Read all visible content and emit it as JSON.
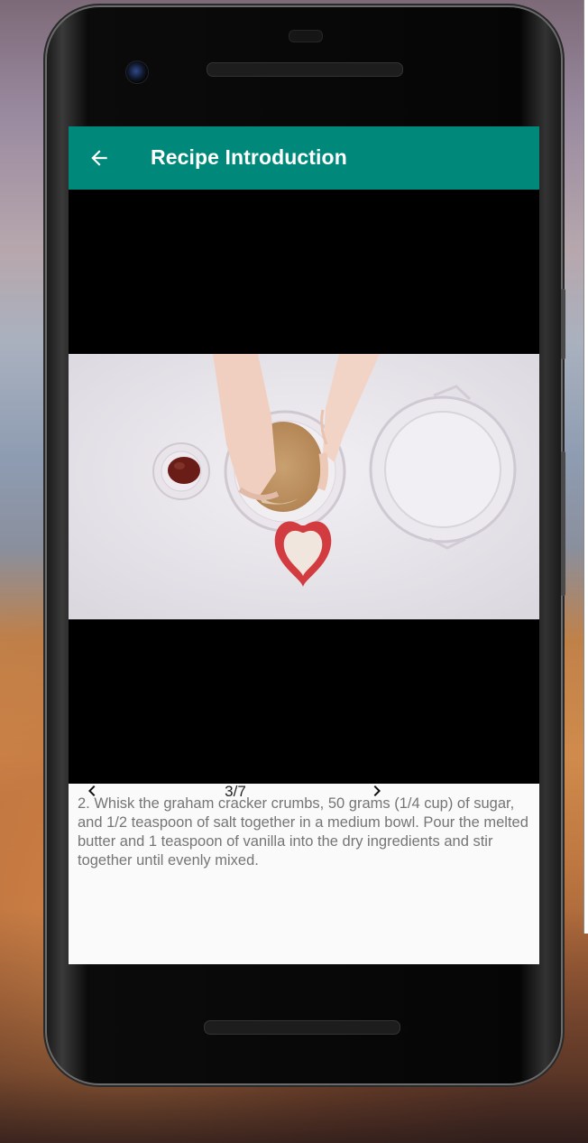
{
  "appbar": {
    "title": "Recipe Introduction",
    "back_icon": "arrow-left-icon",
    "color": "#00897b"
  },
  "media": {
    "icon": "video-frame"
  },
  "step": {
    "text": "2. Whisk the graham cracker crumbs, 50 grams (1/4 cup) of sugar, and 1/2 teaspoon of salt together in a medium bowl. Pour the melted butter and 1 teaspoon of vanilla into the dry ingredients and stir together until evenly mixed.",
    "counter": "3/7",
    "prev_icon": "chevron-left-icon",
    "next_icon": "chevron-right-icon"
  }
}
